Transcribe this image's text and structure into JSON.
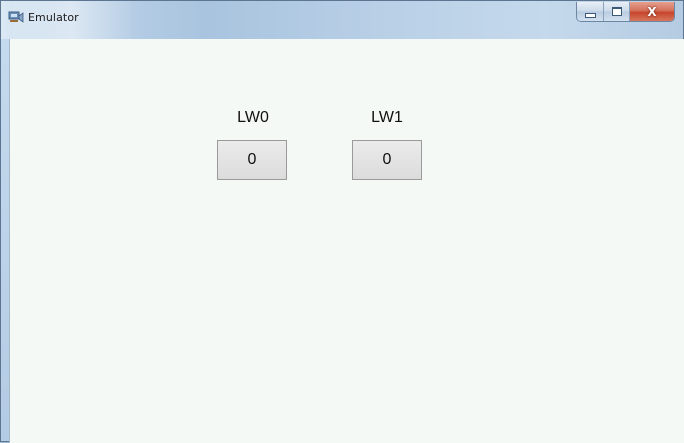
{
  "window": {
    "title": "Emulator",
    "icon": "emulator-app-icon",
    "caption_buttons": {
      "minimize_icon": "minimize-icon",
      "maximize_icon": "maximize-icon",
      "close_icon": "close-icon",
      "close_glyph": "X"
    }
  },
  "fields": [
    {
      "label": "LW0",
      "value": "0"
    },
    {
      "label": "LW1",
      "value": "0"
    }
  ],
  "colors": {
    "client_background": "#f5f9f5",
    "close_button": "#c7452b",
    "value_box": "#e3e3e3"
  }
}
